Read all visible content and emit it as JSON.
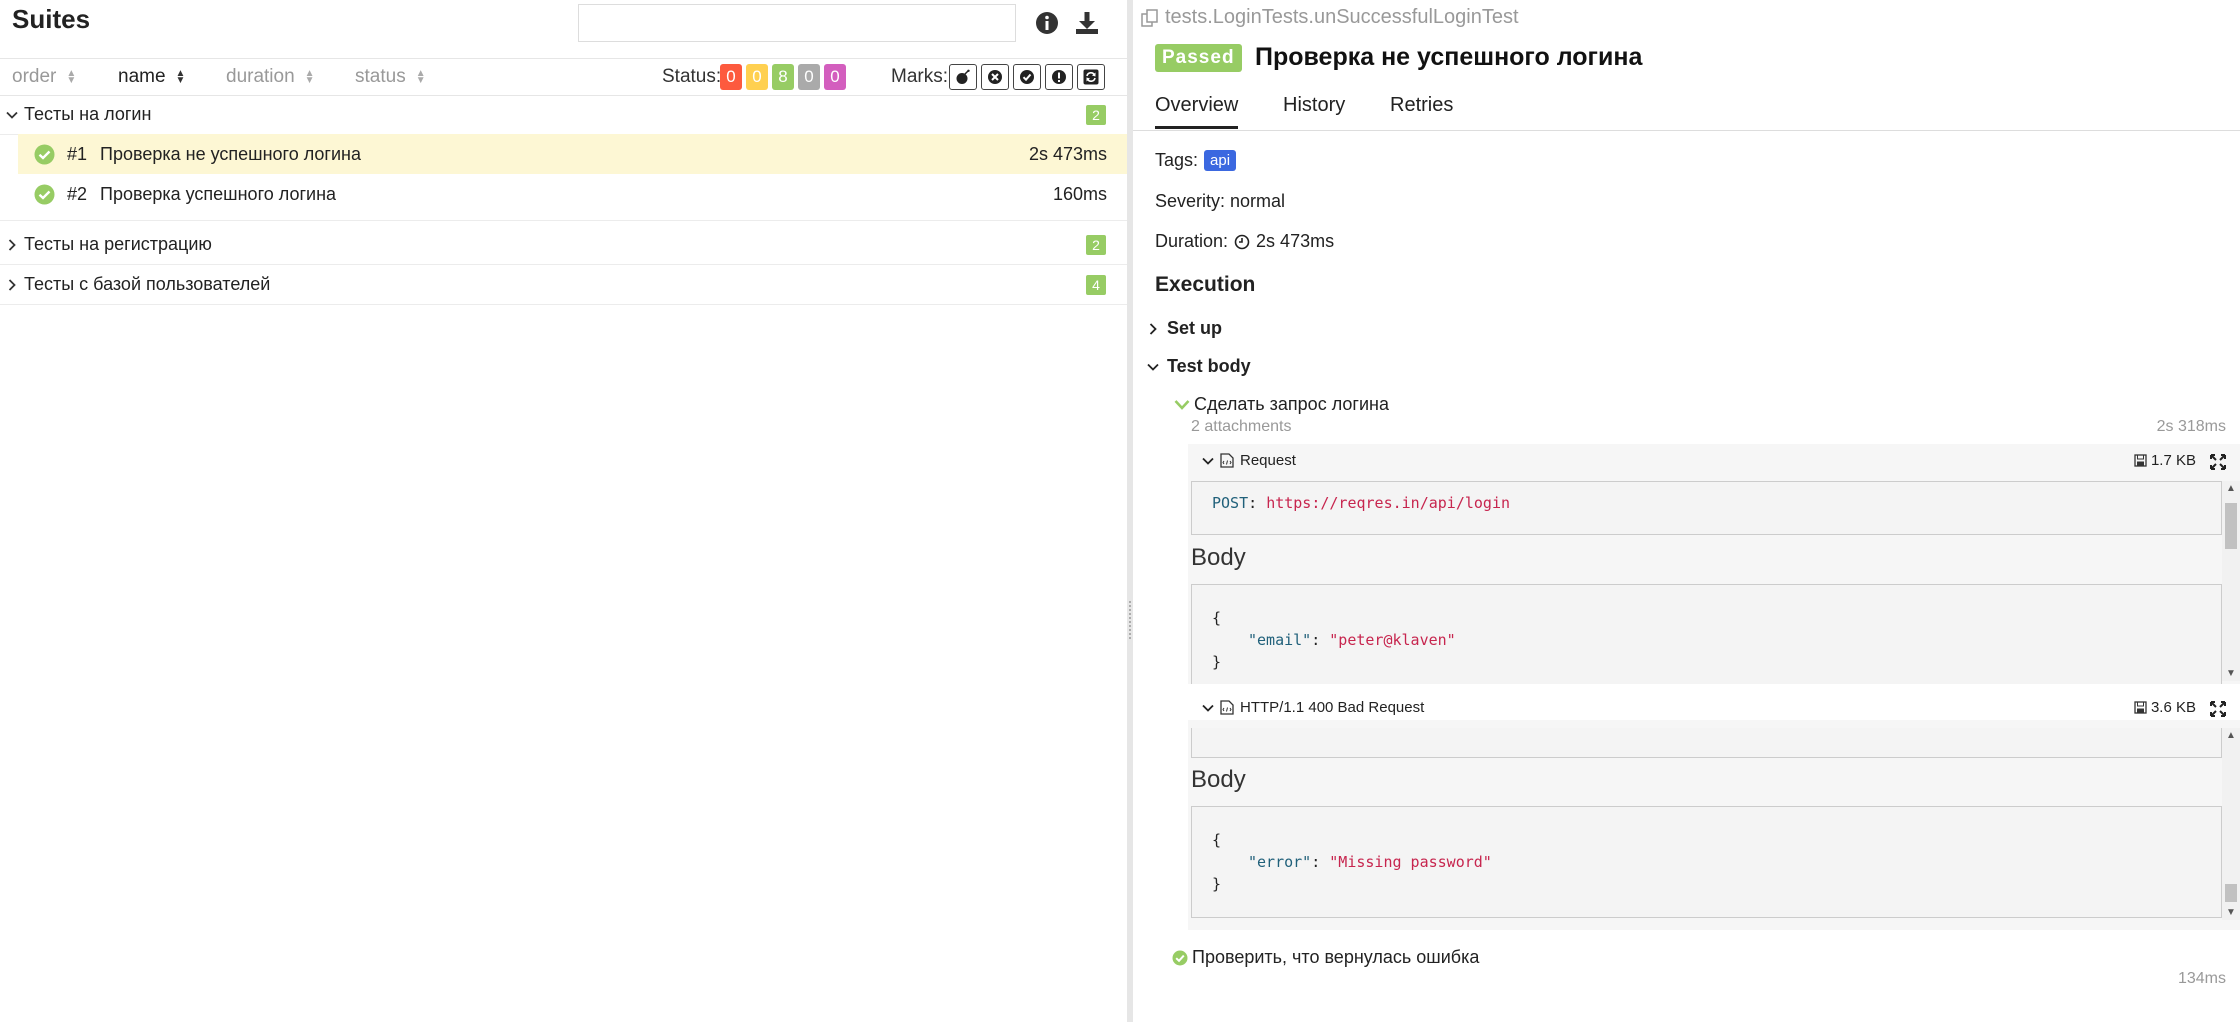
{
  "left": {
    "title": "Suites",
    "search": {
      "value": "",
      "placeholder": ""
    },
    "sort": [
      {
        "label": "order",
        "active": false
      },
      {
        "label": "name",
        "active": true
      },
      {
        "label": "duration",
        "active": false
      },
      {
        "label": "status",
        "active": false
      }
    ],
    "status_label": "Status:",
    "status_counts": [
      {
        "value": "0",
        "color": "#fd5a3e"
      },
      {
        "value": "0",
        "color": "#ffd050"
      },
      {
        "value": "8",
        "color": "#97cc64"
      },
      {
        "value": "0",
        "color": "#aaaaaa"
      },
      {
        "value": "0",
        "color": "#d35ebe"
      }
    ],
    "marks_label": "Marks:",
    "groups": [
      {
        "name": "Тесты на логин",
        "count": "2",
        "expanded": true,
        "tests": [
          {
            "num": "#1",
            "name": "Проверка не успешного логина",
            "duration": "2s 473ms",
            "selected": true
          },
          {
            "num": "#2",
            "name": "Проверка успешного логина",
            "duration": "160ms",
            "selected": false
          }
        ]
      },
      {
        "name": "Тесты на регистрацию",
        "count": "2",
        "expanded": false
      },
      {
        "name": "Тесты с базой пользователей",
        "count": "4",
        "expanded": false
      }
    ]
  },
  "right": {
    "breadcrumb": "tests.LoginTests.unSuccessfulLoginTest",
    "status": "Passed",
    "title": "Проверка не успешного логина",
    "tabs": [
      "Overview",
      "History",
      "Retries"
    ],
    "tags_label": "Tags:",
    "tag": "api",
    "severity": "Severity: normal",
    "duration_label": "Duration:",
    "duration": "2s 473ms",
    "execution_title": "Execution",
    "setup_label": "Set up",
    "testbody_label": "Test body",
    "step1": {
      "name": "Сделать запрос логина",
      "attachments": "2 attachments",
      "duration": "2s 318ms"
    },
    "request": {
      "name": "Request",
      "size": "1.7 KB",
      "method": "POST",
      "url": "https://reqres.in/api/login",
      "body_heading": "Body",
      "open_brace": "{",
      "key": "\"email\"",
      "colon": ":",
      "value": "\"peter@klaven\"",
      "close_brace": "}"
    },
    "response": {
      "name": "HTTP/1.1 400 Bad Request",
      "size": "3.6 KB",
      "body_heading": "Body",
      "open_brace": "{",
      "key": "\"error\"",
      "colon": ":",
      "value": "\"Missing password\"",
      "close_brace": "}"
    },
    "step2": {
      "name": "Проверить, что вернулась ошибка",
      "duration": "134ms"
    }
  }
}
